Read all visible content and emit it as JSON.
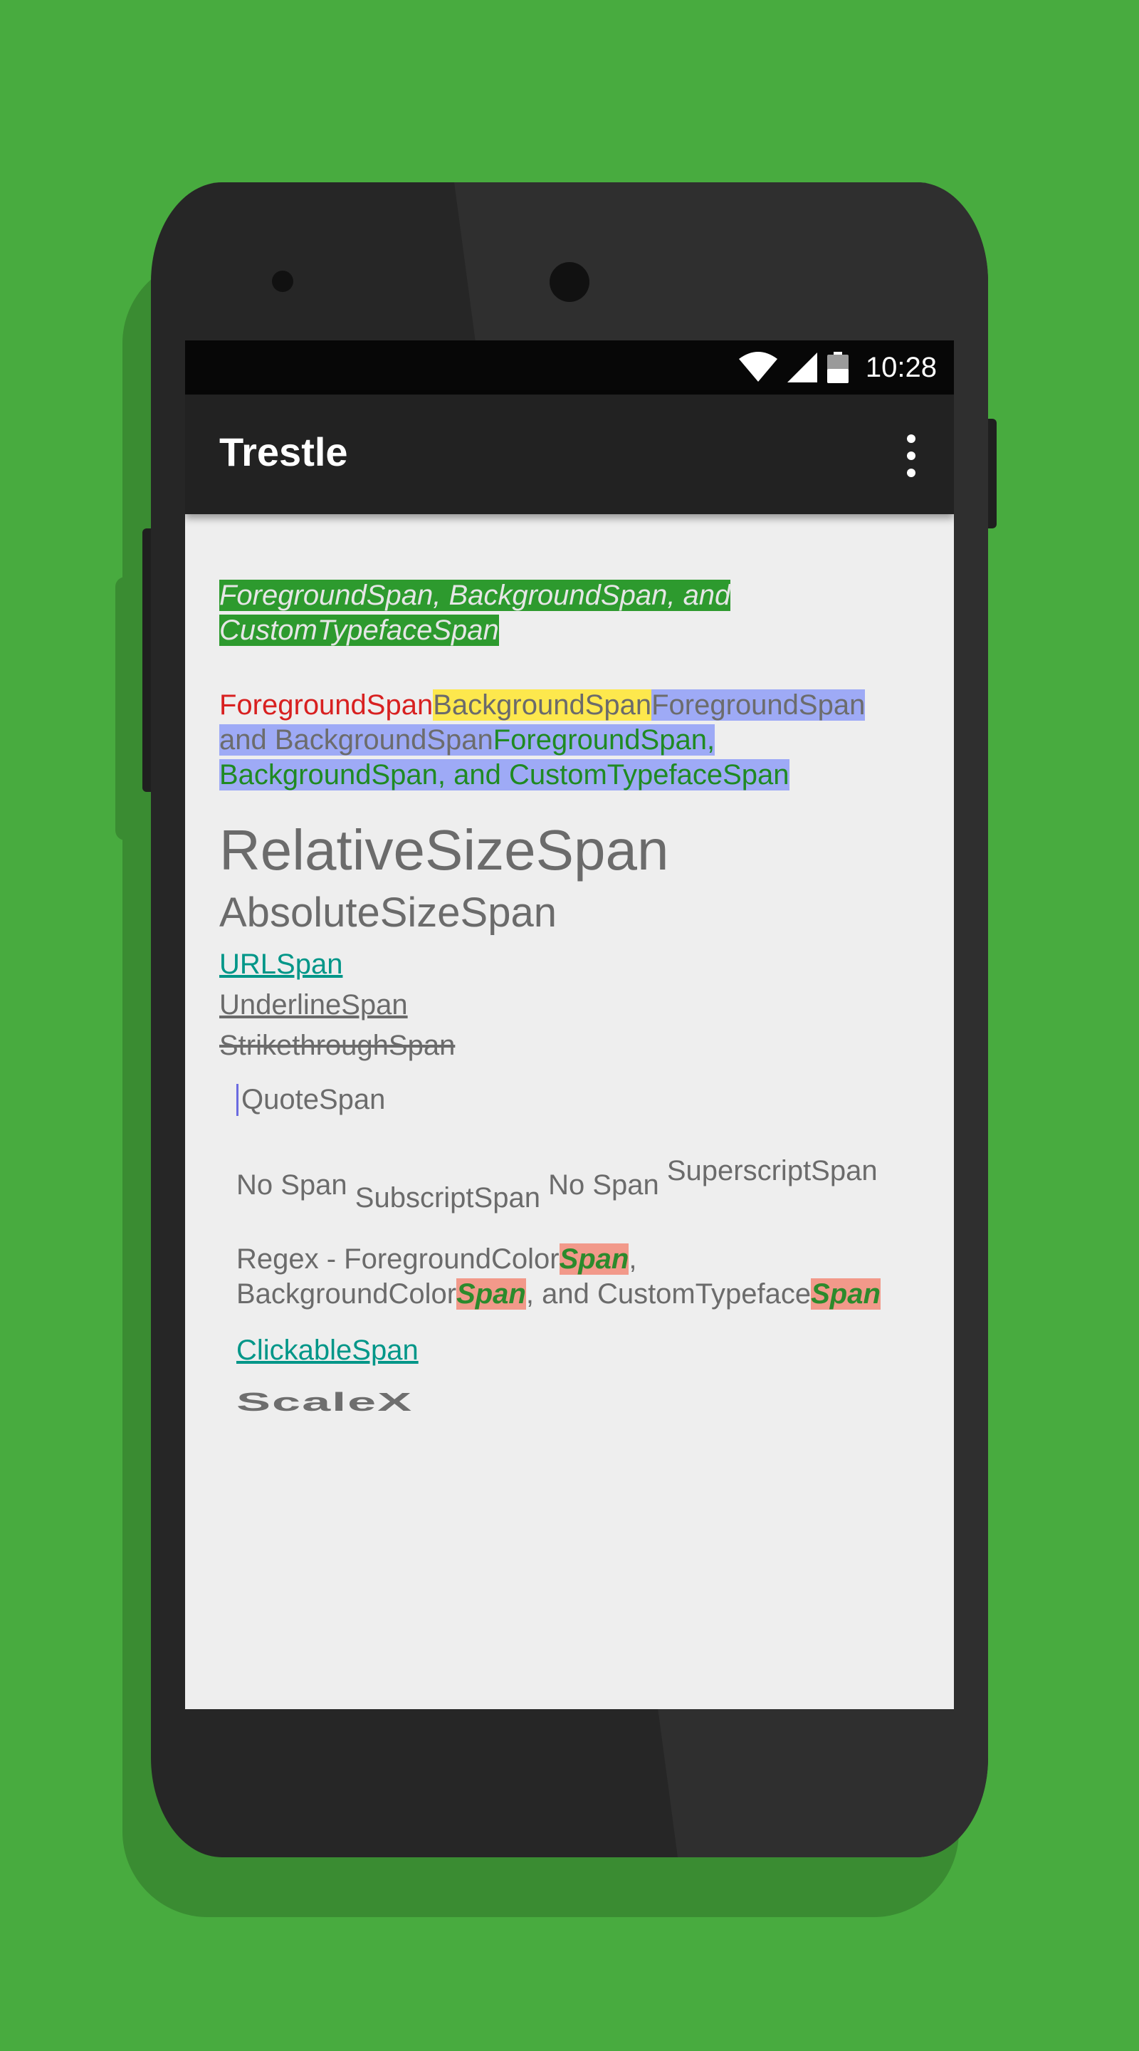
{
  "status_bar": {
    "time": "10:28",
    "icons": [
      "wifi-icon",
      "signal-icon",
      "battery-icon"
    ]
  },
  "app_bar": {
    "title": "Trestle",
    "overflow_icon": "more-vert-icon"
  },
  "samples": {
    "custom_typeface": {
      "line1": "ForegroundSpan, BackgroundSpan, and",
      "line2": "CustomTypefaceSpan"
    },
    "combined": {
      "foreground": "ForegroundSpan",
      "background": "BackgroundSpan",
      "fg_bg_part1": "ForegroundSpan",
      "fg_bg_part2": "and BackgroundSpan",
      "fg_bg_typeface_part1": "ForegroundSpan,",
      "fg_bg_typeface_part2": "BackgroundSpan, and CustomTypefaceSpan"
    },
    "relative_size": "RelativeSizeSpan",
    "absolute_size": "AbsoluteSizeSpan",
    "url": "URLSpan",
    "underline": "UnderlineSpan",
    "strikethrough": "StrikethroughSpan",
    "quote": "QuoteSpan",
    "sub_sup": {
      "no_span_1": "No Span",
      "subscript": "SubscriptSpan",
      "no_span_2": "No Span",
      "superscript": "SuperscriptSpan"
    },
    "regex": {
      "prefix": "Regex - ForegroundColor",
      "match": "Span",
      "comma": ",",
      "middle": "BackgroundColor",
      "and_text": ", and CustomTypeface"
    },
    "clickable": "ClickableSpan",
    "scale_x": "ScaleX"
  },
  "colors": {
    "background": "#48ab3f",
    "app_bar": "#222222",
    "link": "#009688",
    "foreground_red": "#d82020",
    "background_yellow": "#fde84d",
    "background_blue": "#9eaaf6",
    "regex_highlight": "#f2998a"
  }
}
